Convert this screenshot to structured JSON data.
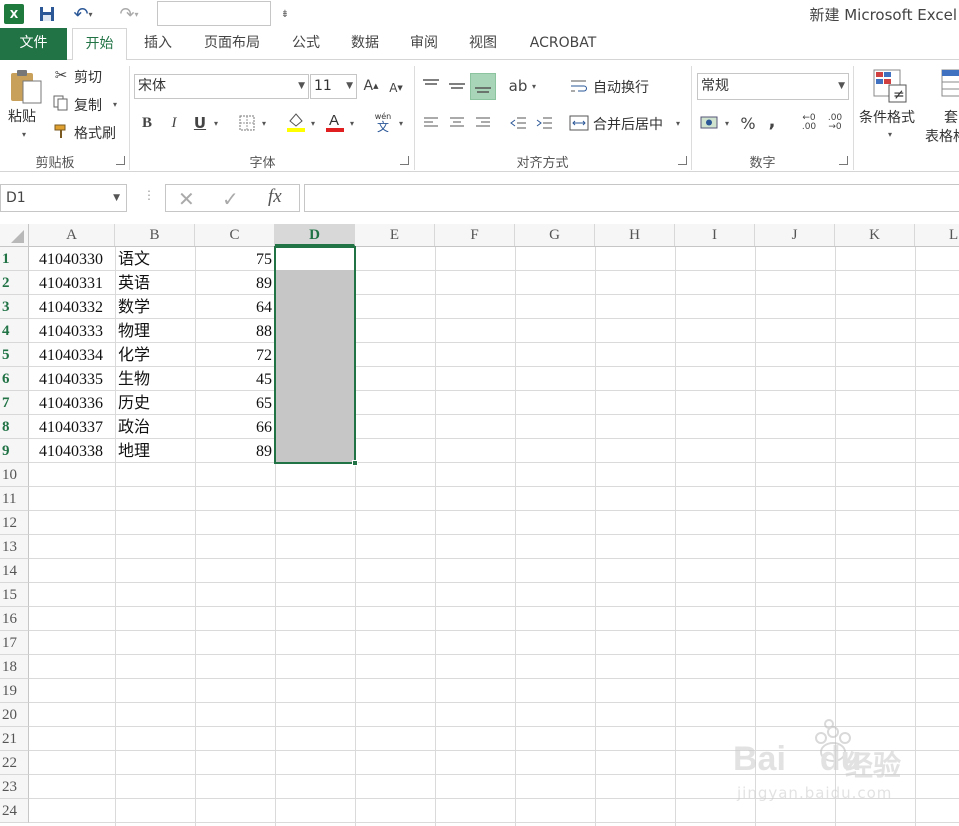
{
  "title_bar": {
    "app_icon": "excel-logo-icon",
    "logo_text": "X",
    "title": "新建 Microsoft Excel"
  },
  "tabs": [
    {
      "label": "文件"
    },
    {
      "label": "开始",
      "active": true
    },
    {
      "label": "插入"
    },
    {
      "label": "页面布局"
    },
    {
      "label": "公式"
    },
    {
      "label": "数据"
    },
    {
      "label": "审阅"
    },
    {
      "label": "视图"
    },
    {
      "label": "ACROBAT"
    }
  ],
  "ribbon": {
    "clipboard": {
      "paste": "粘贴",
      "cut": "剪切",
      "copy": "复制",
      "format_painter": "格式刷",
      "label": "剪贴板"
    },
    "font": {
      "font_name": "宋体",
      "font_size": "11",
      "bold": "B",
      "italic": "I",
      "underline": "U",
      "phonetic_top": "wén",
      "phonetic_bottom": "文",
      "font_color": "#e02020",
      "highlight_color": "#ffff00",
      "label": "字体"
    },
    "alignment": {
      "wrap_text": "自动换行",
      "merge_center": "合并后居中",
      "label": "对齐方式"
    },
    "number": {
      "format": "常规",
      "percent": "%",
      "comma": ",",
      "label": "数字"
    },
    "styles": {
      "conditional_format": "条件格式",
      "table_format_top": "套",
      "table_format": "表格格"
    }
  },
  "formula_bar": {
    "name_box": "D1",
    "fx": "fx",
    "formula": ""
  },
  "grid": {
    "columns": [
      "A",
      "B",
      "C",
      "D",
      "E",
      "F",
      "G",
      "H",
      "I",
      "J",
      "K",
      "L"
    ],
    "selected_column": "D",
    "rows": [
      "1",
      "2",
      "3",
      "4",
      "5",
      "6",
      "7",
      "8",
      "9",
      "10",
      "11",
      "12",
      "13",
      "14",
      "15",
      "16",
      "17",
      "18",
      "19",
      "20",
      "21",
      "22",
      "23",
      "24"
    ],
    "data": [
      {
        "a": "41040330",
        "b": "语文",
        "c": "75"
      },
      {
        "a": "41040331",
        "b": "英语",
        "c": "89"
      },
      {
        "a": "41040332",
        "b": "数学",
        "c": "64"
      },
      {
        "a": "41040333",
        "b": "物理",
        "c": "88"
      },
      {
        "a": "41040334",
        "b": "化学",
        "c": "72"
      },
      {
        "a": "41040335",
        "b": "生物",
        "c": "45"
      },
      {
        "a": "41040336",
        "b": "历史",
        "c": "65"
      },
      {
        "a": "41040337",
        "b": "政治",
        "c": "66"
      },
      {
        "a": "41040338",
        "b": "地理",
        "c": "89"
      }
    ],
    "selection": "D1:D9",
    "accent_color": "#217346"
  },
  "watermark": {
    "brand": "Bai",
    "brand2": "du",
    "brand_cn": "经验",
    "url": "jingyan.baidu.com"
  }
}
